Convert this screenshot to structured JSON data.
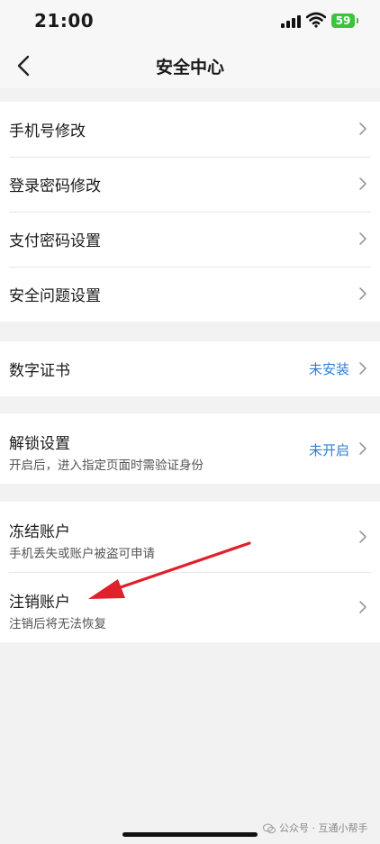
{
  "status_bar": {
    "time": "21:00",
    "battery": "59"
  },
  "nav": {
    "title": "安全中心",
    "back_icon": "chevron-left-icon"
  },
  "groups": [
    {
      "items": [
        {
          "label": "手机号修改"
        },
        {
          "label": "登录密码修改"
        },
        {
          "label": "支付密码设置"
        },
        {
          "label": "安全问题设置"
        }
      ]
    },
    {
      "items": [
        {
          "label": "数字证书",
          "value": "未安装"
        }
      ]
    },
    {
      "items": [
        {
          "label": "解锁设置",
          "subtitle": "开启后，进入指定页面时需验证身份",
          "value": "未开启"
        }
      ]
    },
    {
      "items": [
        {
          "label": "冻结账户",
          "subtitle": "手机丢失或账户被盗可申请"
        },
        {
          "label": "注销账户",
          "subtitle": "注销后将无法恢复"
        }
      ]
    }
  ],
  "watermark": {
    "text": "公众号 · 互通小帮手"
  },
  "colors": {
    "accent_blue": "#2f7fd6",
    "annotation_red": "#e0202a",
    "battery_green": "#3ec23e"
  }
}
